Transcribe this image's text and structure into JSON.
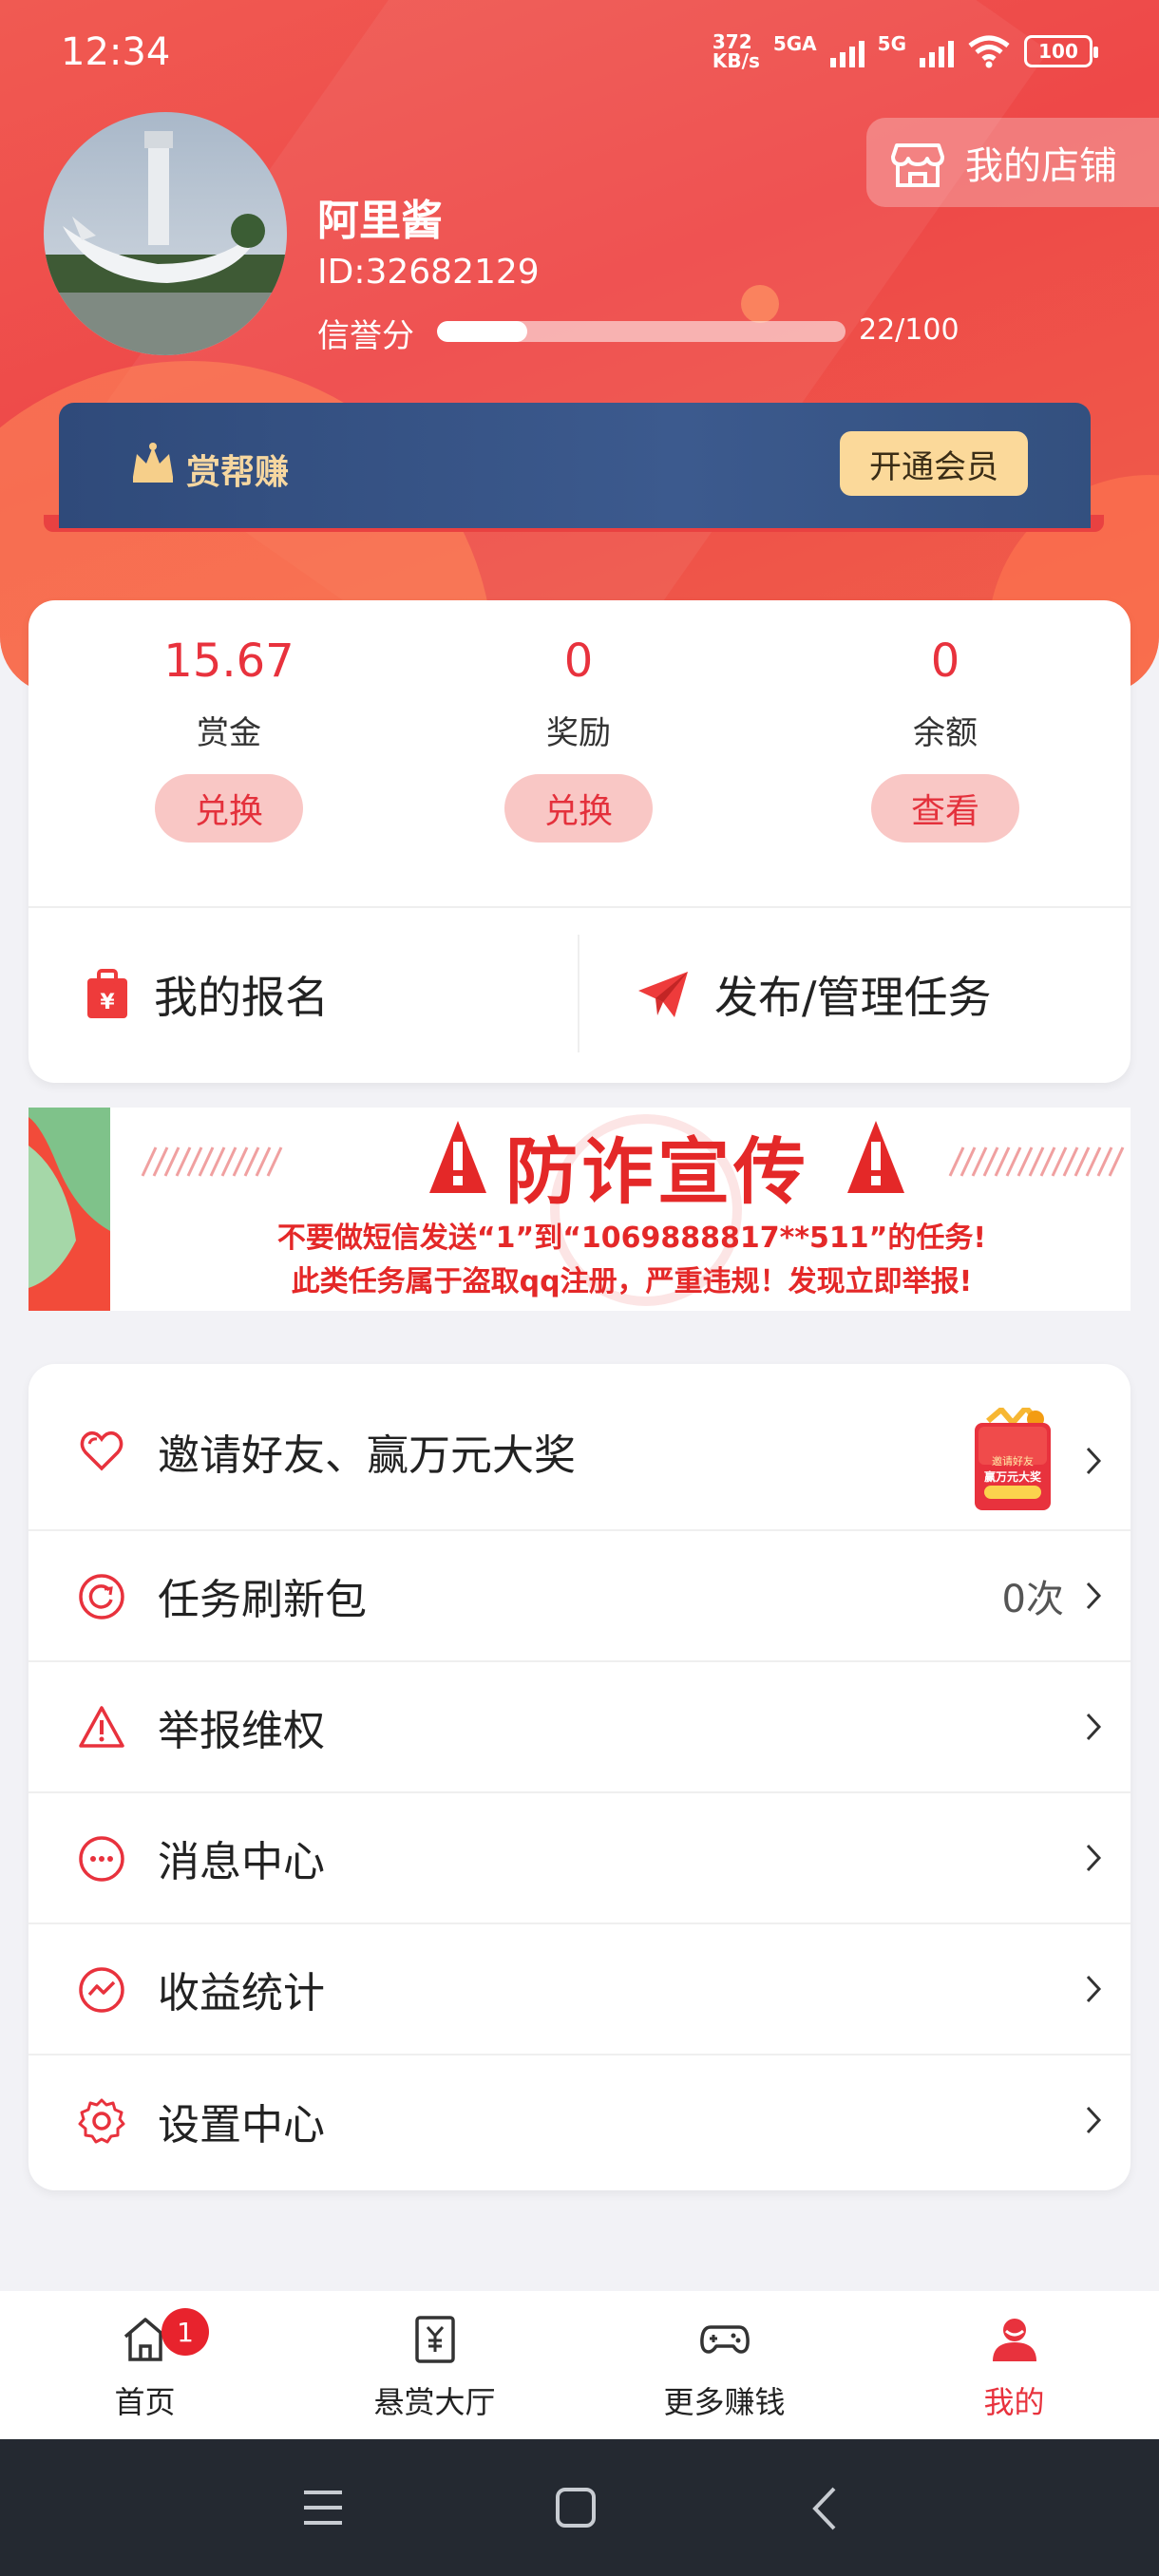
{
  "status_bar": {
    "time": "12:34",
    "net_speed_value": "372",
    "net_speed_unit": "KB/s",
    "signal1_label": "5GA",
    "signal2_label": "5G",
    "battery": "100"
  },
  "profile": {
    "username": "阿里酱",
    "user_id": "ID:32682129",
    "credit_label": "信誉分",
    "credit_text": "22/100",
    "credit_fraction": 0.22,
    "shop_button": "我的店铺"
  },
  "vip": {
    "title": "赏帮赚",
    "button": "开通会员"
  },
  "wallet": {
    "items": [
      {
        "value": "15.67",
        "label": "赏金",
        "button": "兑换"
      },
      {
        "value": "0",
        "label": "奖励",
        "button": "兑换"
      },
      {
        "value": "0",
        "label": "余额",
        "button": "查看"
      }
    ],
    "actions": [
      {
        "label": "我的报名",
        "icon": "signup-bag-icon"
      },
      {
        "label": "发布/管理任务",
        "icon": "paper-plane-icon"
      }
    ]
  },
  "banner": {
    "title": "防诈宣传",
    "line1": "不要做短信发送“1”到“1069888817**511”的任务!",
    "line2": "此类任务属于盗取qq注册，严重违规！发现立即举报!"
  },
  "menu": {
    "items": [
      {
        "label": "邀请好友、赢万元大奖",
        "icon": "heart-icon",
        "right": ""
      },
      {
        "label": "任务刷新包",
        "icon": "refresh-icon",
        "right": "0次"
      },
      {
        "label": "举报维权",
        "icon": "warning-icon",
        "right": ""
      },
      {
        "label": "消息中心",
        "icon": "message-icon",
        "right": ""
      },
      {
        "label": "收益统计",
        "icon": "chart-icon",
        "right": ""
      },
      {
        "label": "设置中心",
        "icon": "gear-icon",
        "right": ""
      }
    ],
    "invite_card_text1": "邀请好友",
    "invite_card_text2": "赢万元大奖"
  },
  "tabbar": {
    "tabs": [
      {
        "label": "首页",
        "icon": "home-icon",
        "badge": "1"
      },
      {
        "label": "悬赏大厅",
        "icon": "reward-hall-icon"
      },
      {
        "label": "更多赚钱",
        "icon": "gamepad-icon"
      },
      {
        "label": "我的",
        "icon": "profile-icon"
      }
    ]
  },
  "colors": {
    "accent": "#e8323d",
    "header": "#ee4848",
    "vip_card": "#33507f",
    "vip_gold": "#fbd99a"
  }
}
